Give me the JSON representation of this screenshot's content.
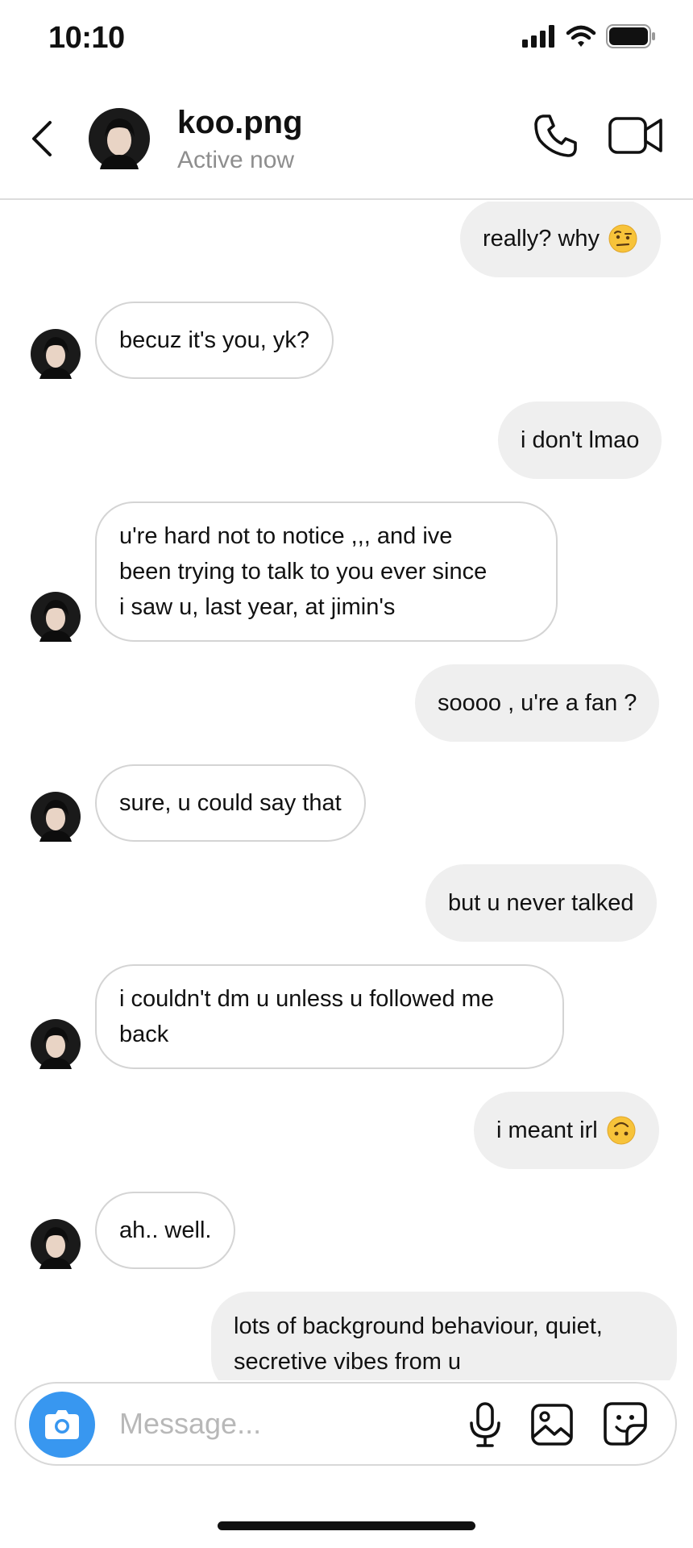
{
  "status_bar": {
    "time": "10:10"
  },
  "header": {
    "name": "koo.png",
    "status": "Active now",
    "avatar_icon": "profile-photo"
  },
  "messages": [
    {
      "direction": "out",
      "text": "really? why",
      "emoji": "face-with-raised-eyebrow"
    },
    {
      "direction": "in",
      "text": "becuz it's you, yk?"
    },
    {
      "direction": "out",
      "text": "i don't lmao"
    },
    {
      "direction": "in",
      "text": "u're hard not to notice ,,, and ive\nbeen trying to talk to you ever since\ni saw u, last year, at jimin's"
    },
    {
      "direction": "out",
      "text": "soooo , u're a fan ?"
    },
    {
      "direction": "in",
      "text": "sure, u could say that"
    },
    {
      "direction": "out",
      "text": "but u never talked"
    },
    {
      "direction": "in",
      "text": "i couldn't dm u unless u followed me\nback"
    },
    {
      "direction": "out",
      "text": "i meant irl",
      "emoji": "upside-down-face"
    },
    {
      "direction": "in",
      "text": "ah.. well."
    },
    {
      "direction": "out",
      "text": "lots of background behaviour, quiet,\nsecretive vibes from u"
    }
  ],
  "composer": {
    "placeholder": "Message...",
    "icons": [
      "camera-icon",
      "microphone-icon",
      "gallery-icon",
      "sticker-icon"
    ]
  },
  "colors": {
    "outgoing_bubble": "#efefef",
    "incoming_border": "#d4d4d4",
    "camera_button": "#3897f0",
    "secondary_text": "#8e8e8e"
  }
}
